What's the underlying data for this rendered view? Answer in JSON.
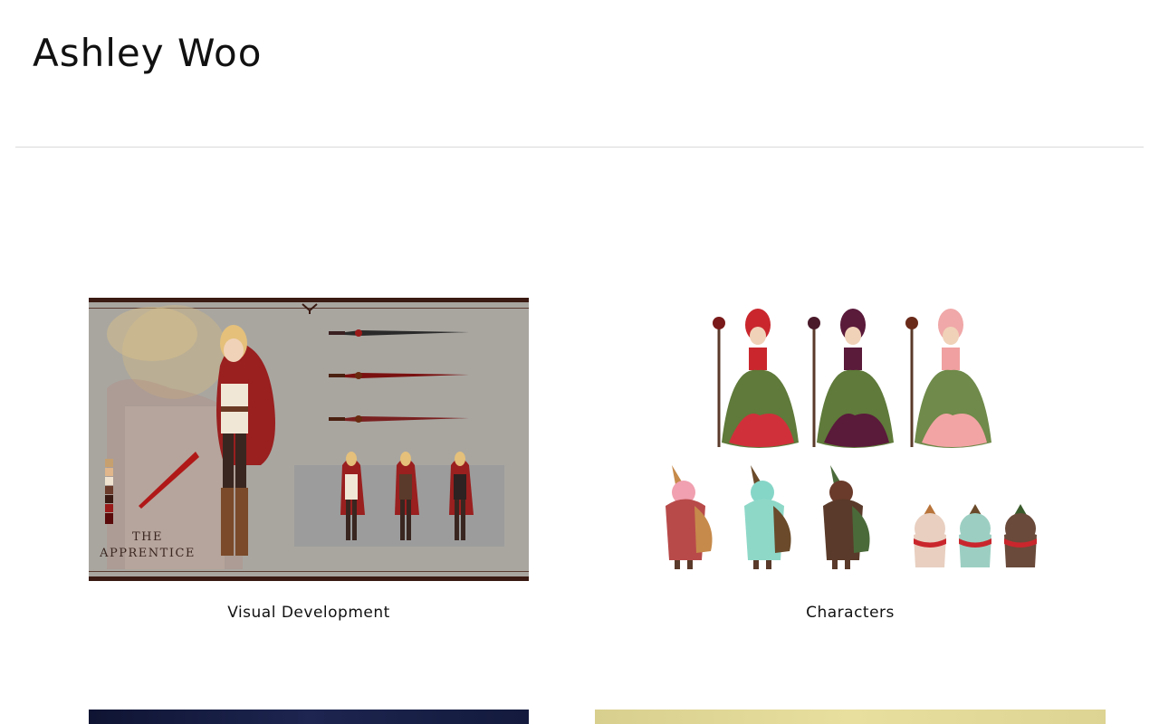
{
  "site": {
    "title": "Ashley Woo"
  },
  "gallery": {
    "tiles": [
      {
        "caption": "Visual Development",
        "image_text": [
          "THE",
          "APPRENTICE"
        ]
      },
      {
        "caption": "Characters"
      }
    ]
  },
  "colors": {
    "background": "#ffffff",
    "divider": "#d9d9d9",
    "text": "#111111"
  }
}
